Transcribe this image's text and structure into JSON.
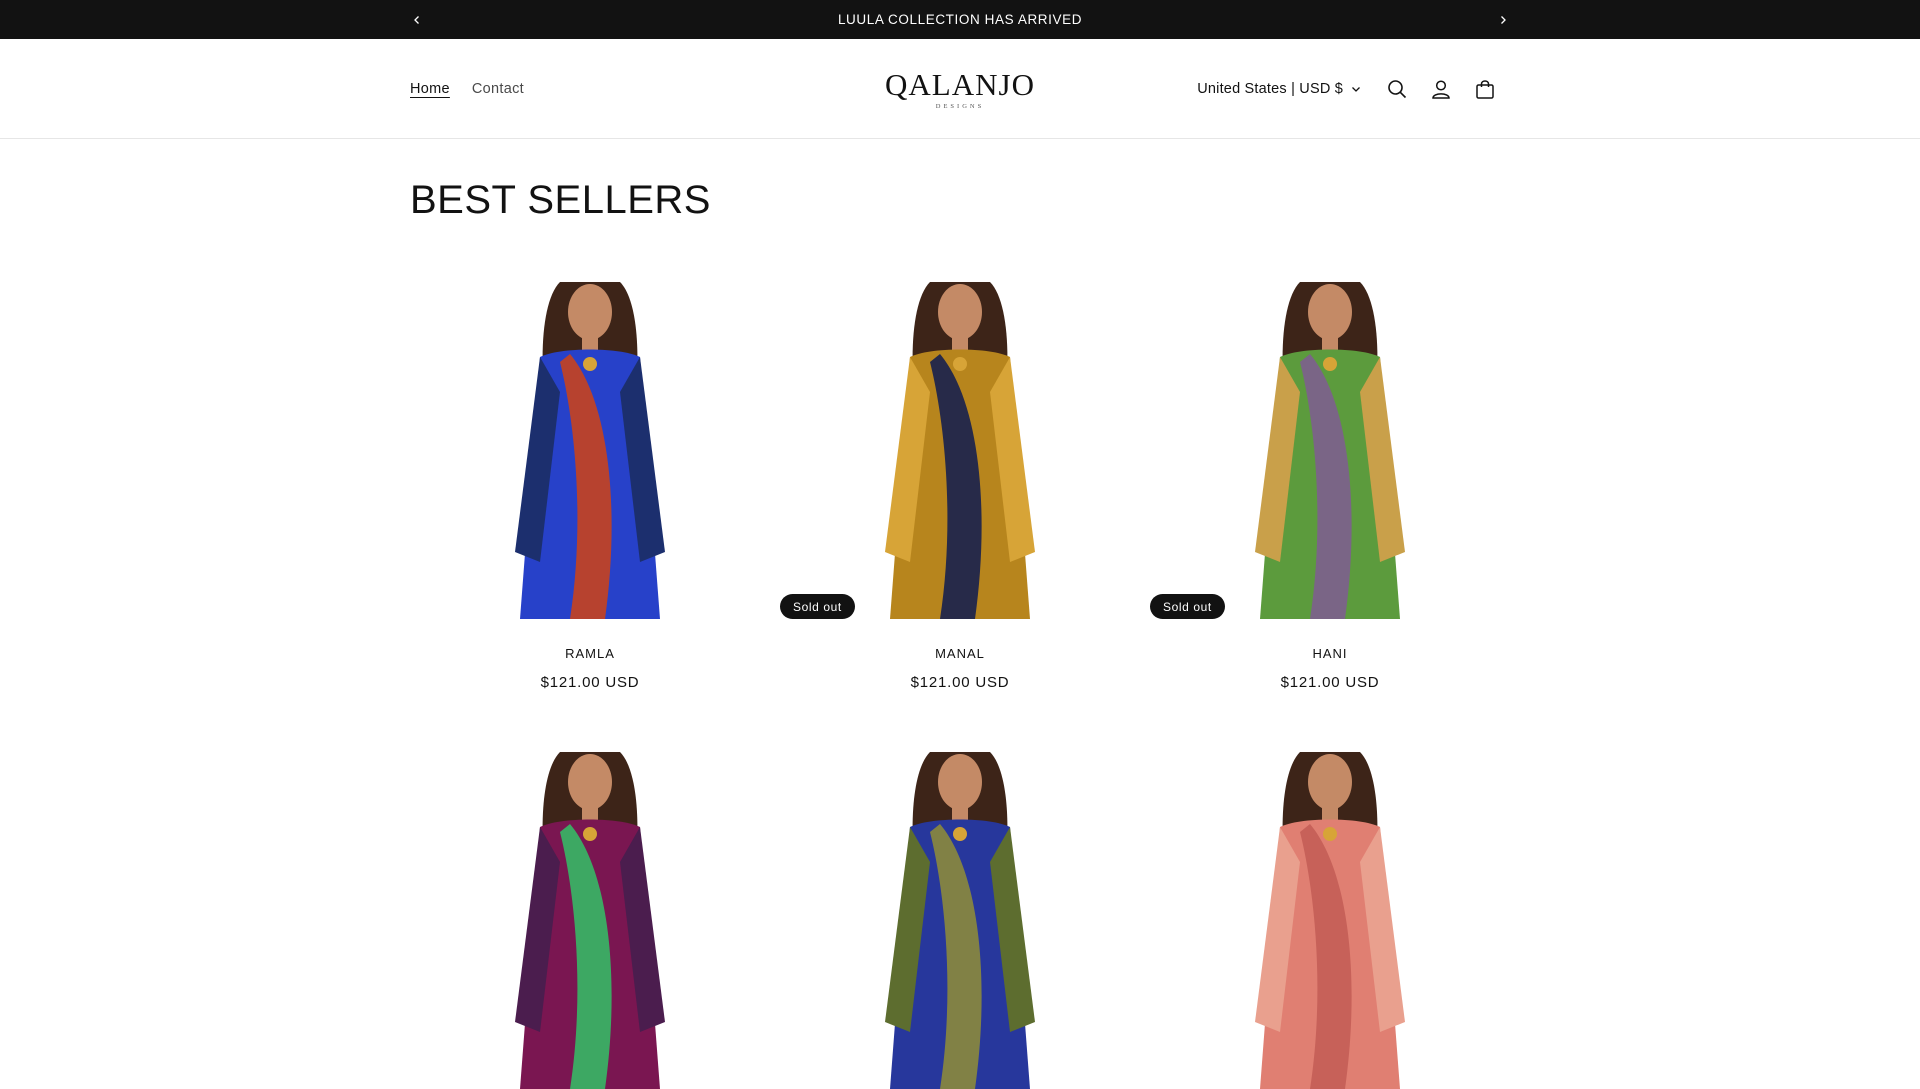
{
  "announcement": {
    "text": "LUULA COLLECTION HAS ARRIVED"
  },
  "nav": {
    "items": [
      {
        "label": "Home"
      },
      {
        "label": "Contact"
      }
    ]
  },
  "brand": {
    "name": "QALANJO",
    "tagline": "DESIGNS"
  },
  "header": {
    "locale": "United States | USD $"
  },
  "icons": {
    "prev": "chevron-left-icon",
    "next": "chevron-right-icon",
    "locale_caret": "chevron-down-icon",
    "search": "search-icon",
    "account": "account-icon",
    "cart": "cart-icon"
  },
  "section": {
    "title": "BEST SELLERS"
  },
  "products": [
    {
      "title": "RAMLA",
      "price": "$121.00 USD",
      "badge": "",
      "colors": [
        "#2741c9",
        "#c8421e",
        "#1c2f6e"
      ]
    },
    {
      "title": "MANAL",
      "price": "$121.00 USD",
      "badge": "Sold out",
      "colors": [
        "#b7851d",
        "#17204f",
        "#d7a437"
      ]
    },
    {
      "title": "HANI",
      "price": "$121.00 USD",
      "badge": "Sold out",
      "colors": [
        "#5c9b3d",
        "#7d5f8e",
        "#c9a04a"
      ]
    },
    {
      "title": "",
      "price": "",
      "badge": "",
      "colors": [
        "#7a1651",
        "#36b865",
        "#4b1d4e"
      ]
    },
    {
      "title": "",
      "price": "",
      "badge": "",
      "colors": [
        "#27379c",
        "#8c8a3c",
        "#5d6d2f"
      ]
    },
    {
      "title": "",
      "price": "",
      "badge": "",
      "colors": [
        "#e07f72",
        "#c45e57",
        "#e9a08e"
      ]
    }
  ],
  "colors": {
    "topbar": "#121212",
    "text": "#121212",
    "skin": "#c48a66",
    "hair": "#3d2418"
  }
}
